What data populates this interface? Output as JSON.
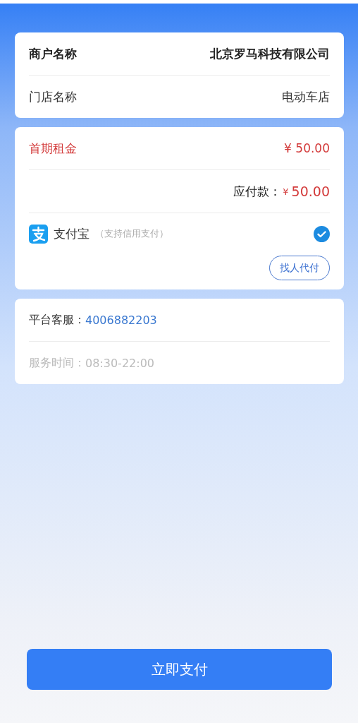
{
  "merchant": {
    "rows": [
      {
        "label": "商户名称",
        "value": "北京罗马科技有限公司",
        "kind": "bold"
      },
      {
        "label": "门店名称",
        "value": "电动车店",
        "kind": "plain"
      }
    ]
  },
  "payment": {
    "rent": {
      "label": "首期租金",
      "amount": "¥ 50.00"
    },
    "due": {
      "label": "应付款：",
      "currency": "¥",
      "amount": "50.00"
    },
    "methods": [
      {
        "name": "支付宝",
        "note": "（支持信用支付）",
        "selected": true
      }
    ],
    "proxy_button": "找人代付"
  },
  "service": {
    "hotline": {
      "label": "平台客服：",
      "value": "4006882203"
    },
    "hours": {
      "label": "服务时间：",
      "value": "08:30-22:00"
    }
  },
  "pay_button": "立即支付"
}
